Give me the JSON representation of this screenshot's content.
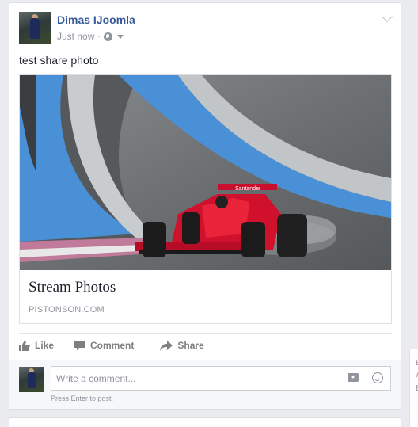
{
  "post": {
    "author": "Dimas IJoomla",
    "timestamp": "Just now",
    "separator": "·",
    "privacy_icon": "globe-icon",
    "text": "test share photo"
  },
  "shared_link": {
    "title": "Stream Photos",
    "domain": "PISTONSON.COM",
    "image_sponsor_text": "Santander"
  },
  "actions": {
    "like": "Like",
    "comment": "Comment",
    "share": "Share"
  },
  "comment_box": {
    "placeholder": "Write a comment...",
    "hint": "Press Enter to post."
  },
  "colors": {
    "author_link": "#365899",
    "action_text": "#7f7f7f",
    "meta_text": "#90949c",
    "page_background": "#e9ebee"
  }
}
